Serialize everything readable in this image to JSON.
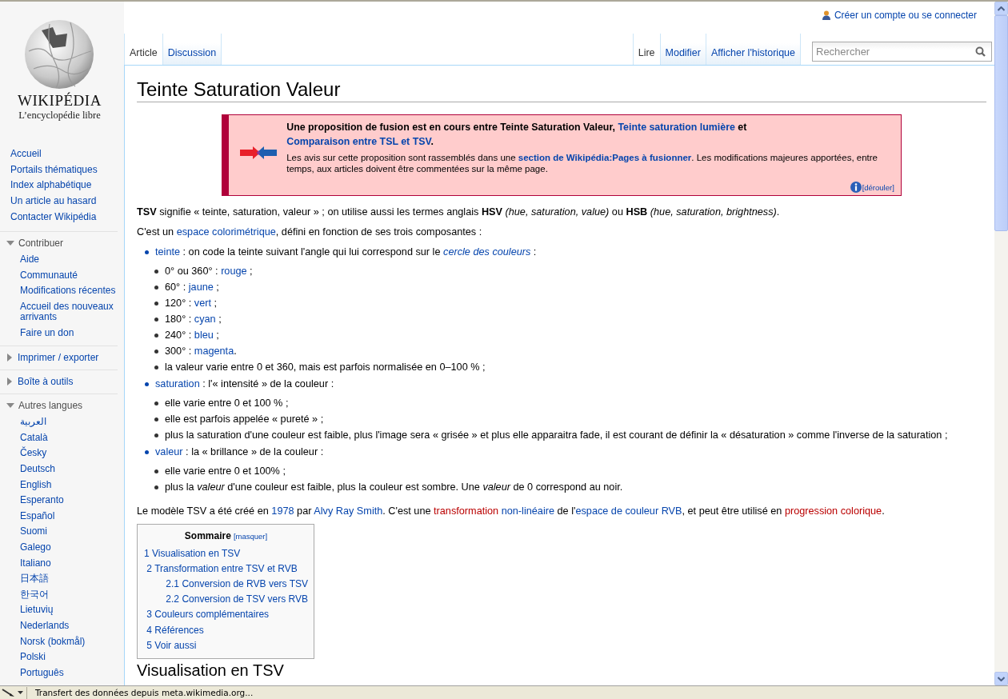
{
  "personal_link": "Créer un compte ou se connecter",
  "logo": {
    "wordmark": "WIKIPÉDIA",
    "tagline": "L’encyclopédie libre"
  },
  "navigation": [
    "Accueil",
    "Portails thématiques",
    "Index alphabétique",
    "Un article au hasard",
    "Contacter Wikipédia"
  ],
  "sidebar_sections": [
    {
      "title": "Contribuer",
      "expanded": true,
      "items": [
        "Aide",
        "Communauté",
        "Modifications récentes",
        "Accueil des nouveaux arrivants",
        "Faire un don"
      ]
    },
    {
      "title": "Imprimer / exporter",
      "expanded": false
    },
    {
      "title": "Boîte à outils",
      "expanded": false
    },
    {
      "title": "Autres langues",
      "expanded": true,
      "items": [
        "العربية",
        "Català",
        "Česky",
        "Deutsch",
        "English",
        "Esperanto",
        "Español",
        "Suomi",
        "Galego",
        "Italiano",
        "日本語",
        "한국어",
        "Lietuvių",
        "Nederlands",
        "Norsk (bokmål)",
        "Polski",
        "Português"
      ]
    }
  ],
  "namespace_tabs": [
    {
      "label": "Article",
      "selected": true
    },
    {
      "label": "Discussion",
      "selected": false
    }
  ],
  "view_tabs": [
    {
      "label": "Lire",
      "selected": true
    },
    {
      "label": "Modifier",
      "selected": false
    },
    {
      "label": "Afficher l'historique",
      "selected": false
    }
  ],
  "search": {
    "placeholder": "Rechercher"
  },
  "article": {
    "title": "Teinte Saturation Valeur",
    "banner": {
      "heading": [
        {
          "kind": "text",
          "text": "Une proposition de fusion est en cours entre Teinte Saturation Valeur, "
        },
        {
          "kind": "link",
          "text": "Teinte saturation lumière"
        },
        {
          "kind": "text",
          "text": " et "
        },
        {
          "kind": "link",
          "text": "Comparaison entre TSL et TSV"
        },
        {
          "kind": "text",
          "text": "."
        }
      ],
      "body": [
        {
          "kind": "text",
          "text": "Les avis sur cette proposition sont rassemblés dans une "
        },
        {
          "kind": "link",
          "text": "**section de Wikipédia:Pages à fusionner**"
        },
        {
          "kind": "text",
          "text": ". Les modifications majeures apportées, entre temps, aux articles doivent être commentées sur la même page."
        }
      ],
      "toggle": "[dérouler]"
    },
    "blocks": [
      {
        "kind": "paragraph",
        "segments": [
          {
            "kind": "text",
            "text": "**TSV** signifie « teinte, saturation, valeur » ; on utilise aussi les termes anglais **HSV** *(hue, saturation, value)* ou **HSB** *(hue, saturation, brightness)*."
          }
        ]
      },
      {
        "kind": "paragraph",
        "segments": [
          {
            "kind": "text",
            "text": "C'est un "
          },
          {
            "kind": "link",
            "text": "espace colorimétrique"
          },
          {
            "kind": "text",
            "text": ", défini en fonction de ses trois composantes :"
          }
        ]
      },
      {
        "kind": "list",
        "items": [
          {
            "segments": [
              {
                "kind": "link",
                "text": "teinte"
              },
              {
                "kind": "text",
                "text": " : on code la teinte suivant l'angle qui lui correspond sur le "
              },
              {
                "kind": "link",
                "text": "*cercle des couleurs*"
              },
              {
                "kind": "text",
                "text": " :"
              }
            ],
            "children": [
              {
                "segments": [
                  {
                    "kind": "text",
                    "text": "0° ou 360° : "
                  },
                  {
                    "kind": "link",
                    "text": "rouge"
                  },
                  {
                    "kind": "text",
                    "text": " ;"
                  }
                ]
              },
              {
                "segments": [
                  {
                    "kind": "text",
                    "text": "60° : "
                  },
                  {
                    "kind": "link",
                    "text": "jaune"
                  },
                  {
                    "kind": "text",
                    "text": " ;"
                  }
                ]
              },
              {
                "segments": [
                  {
                    "kind": "text",
                    "text": "120° : "
                  },
                  {
                    "kind": "link",
                    "text": "vert"
                  },
                  {
                    "kind": "text",
                    "text": " ;"
                  }
                ]
              },
              {
                "segments": [
                  {
                    "kind": "text",
                    "text": "180° : "
                  },
                  {
                    "kind": "link",
                    "text": "cyan"
                  },
                  {
                    "kind": "text",
                    "text": " ;"
                  }
                ]
              },
              {
                "segments": [
                  {
                    "kind": "text",
                    "text": "240° : "
                  },
                  {
                    "kind": "link",
                    "text": "bleu"
                  },
                  {
                    "kind": "text",
                    "text": " ;"
                  }
                ]
              },
              {
                "segments": [
                  {
                    "kind": "text",
                    "text": "300° : "
                  },
                  {
                    "kind": "link",
                    "text": "magenta"
                  },
                  {
                    "kind": "text",
                    "text": "."
                  }
                ]
              },
              {
                "segments": [
                  {
                    "kind": "text",
                    "text": "la valeur varie entre 0 et 360, mais est parfois normalisée en 0–100 % ;"
                  }
                ]
              }
            ]
          },
          {
            "segments": [
              {
                "kind": "link",
                "text": "saturation"
              },
              {
                "kind": "text",
                "text": " : l'« intensité » de la couleur :"
              }
            ],
            "children": [
              {
                "segments": [
                  {
                    "kind": "text",
                    "text": "elle varie entre 0 et 100 % ;"
                  }
                ]
              },
              {
                "segments": [
                  {
                    "kind": "text",
                    "text": "elle est parfois appelée « pureté » ;"
                  }
                ]
              },
              {
                "segments": [
                  {
                    "kind": "text",
                    "text": "plus la saturation d'une couleur est faible, plus l'image sera « grisée » et plus elle apparaitra fade, il est courant de définir la « désaturation » comme l'inverse de la saturation ;"
                  }
                ]
              }
            ]
          },
          {
            "segments": [
              {
                "kind": "link",
                "text": "valeur"
              },
              {
                "kind": "text",
                "text": " : la « brillance » de la couleur :"
              }
            ],
            "children": [
              {
                "segments": [
                  {
                    "kind": "text",
                    "text": "elle varie entre 0 et 100% ;"
                  }
                ]
              },
              {
                "segments": [
                  {
                    "kind": "text",
                    "text": "plus la *valeur* d'une couleur est faible, plus la couleur est sombre. Une *valeur* de 0 correspond au noir."
                  }
                ]
              }
            ]
          }
        ]
      },
      {
        "kind": "paragraph",
        "segments": [
          {
            "kind": "text",
            "text": "Le modèle TSV a été créé en "
          },
          {
            "kind": "link",
            "text": "1978"
          },
          {
            "kind": "text",
            "text": " par "
          },
          {
            "kind": "link",
            "text": "Alvy Ray Smith"
          },
          {
            "kind": "text",
            "text": ". C'est une "
          },
          {
            "kind": "redlink",
            "text": "transformation"
          },
          {
            "kind": "link",
            "text": "non-linéaire"
          },
          {
            "kind": "text",
            "text": " de l'"
          },
          {
            "kind": "link",
            "text": "espace de couleur RVB"
          },
          {
            "kind": "text",
            "text": ", et peut être utilisé en "
          },
          {
            "kind": "redlink",
            "text": "progression colorique"
          },
          {
            "kind": "text",
            "text": "."
          }
        ]
      }
    ],
    "toc": {
      "title": "Sommaire",
      "toggle": "[masquer]",
      "items": [
        {
          "label": "1 Visualisation en TSV"
        },
        {
          "label": "2 Transformation entre TSV et RVB",
          "children": [
            {
              "label": "2.1 Conversion de RVB vers TSV"
            },
            {
              "label": "2.2 Conversion de TSV vers RVB"
            }
          ]
        },
        {
          "label": "3 Couleurs complémentaires"
        },
        {
          "label": "4 Références"
        },
        {
          "label": "5 Voir aussi"
        }
      ]
    },
    "next_heading": "Visualisation en TSV"
  },
  "status_bar": {
    "text": "Transfert des données depuis meta.wikimedia.org..."
  }
}
